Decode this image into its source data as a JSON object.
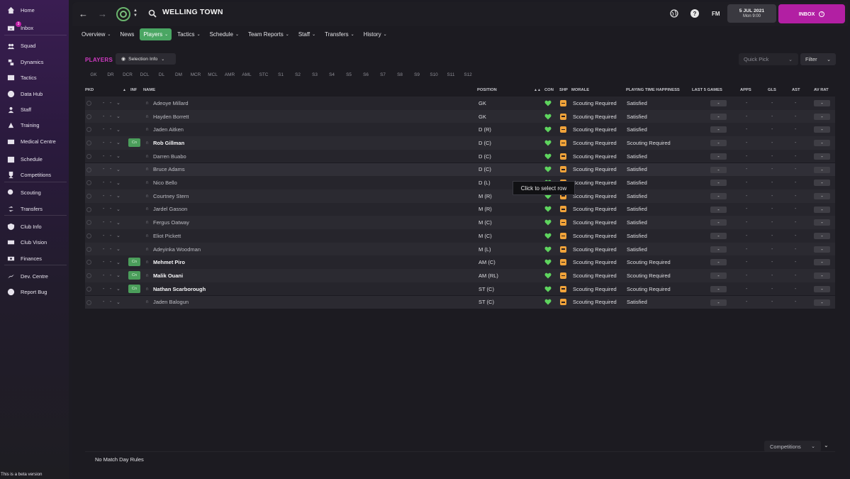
{
  "sidebar": {
    "items": [
      {
        "label": "Home",
        "icon": "home-icon"
      },
      {
        "label": "Inbox",
        "icon": "inbox-icon",
        "badge": "3"
      },
      {
        "label": "Squad",
        "icon": "squad-icon"
      },
      {
        "label": "Dynamics",
        "icon": "dynamics-icon"
      },
      {
        "label": "Tactics",
        "icon": "tactics-icon"
      },
      {
        "label": "Data Hub",
        "icon": "data-hub-icon"
      },
      {
        "label": "Staff",
        "icon": "staff-icon"
      },
      {
        "label": "Training",
        "icon": "training-icon"
      },
      {
        "label": "Medical Centre",
        "icon": "medical-icon"
      },
      {
        "label": "Schedule",
        "icon": "schedule-icon"
      },
      {
        "label": "Competitions",
        "icon": "trophy-icon"
      },
      {
        "label": "Scouting",
        "icon": "scouting-icon"
      },
      {
        "label": "Transfers",
        "icon": "transfers-icon"
      },
      {
        "label": "Club Info",
        "icon": "shield-icon"
      },
      {
        "label": "Club Vision",
        "icon": "vision-icon"
      },
      {
        "label": "Finances",
        "icon": "finances-icon"
      },
      {
        "label": "Dev. Centre",
        "icon": "dev-centre-icon"
      },
      {
        "label": "Report Bug",
        "icon": "report-bug-icon"
      }
    ],
    "beta_text": "This is a beta version"
  },
  "header": {
    "club_name": "WELLING TOWN",
    "fm_label": "FM",
    "date": "5 JUL 2021",
    "day_time": "Mon 9:00",
    "inbox_label": "INBOX"
  },
  "menu": [
    {
      "label": "Overview",
      "caret": true
    },
    {
      "label": "News",
      "caret": false
    },
    {
      "label": "Players",
      "caret": true,
      "active": true
    },
    {
      "label": "Tactics",
      "caret": true
    },
    {
      "label": "Schedule",
      "caret": true
    },
    {
      "label": "Team Reports",
      "caret": true
    },
    {
      "label": "Staff",
      "caret": true
    },
    {
      "label": "Transfers",
      "caret": true
    },
    {
      "label": "History",
      "caret": true
    }
  ],
  "players_panel": {
    "title": "PLAYERS",
    "selection_info": "Selection Info",
    "quick_pick": "Quick Pick",
    "filter": "Filter",
    "positions": [
      "GK",
      "DR",
      "DCR",
      "DCL",
      "DL",
      "DM",
      "MCR",
      "MCL",
      "AMR",
      "AML",
      "STC",
      "S1",
      "S2",
      "S3",
      "S4",
      "S5",
      "S6",
      "S7",
      "S8",
      "S9",
      "S10",
      "S11",
      "S12"
    ]
  },
  "table": {
    "headers": {
      "pkd": "PKD",
      "inf": "INF",
      "name": "NAME",
      "position": "POSITION",
      "con": "CON",
      "shp": "SHP",
      "morale": "MORALE",
      "happiness": "PLAYING TIME HAPPINESS",
      "last5": "LAST 5 GAMES",
      "apps": "APPS",
      "gls": "GLS",
      "ast": "AST",
      "avrat": "AV RAT"
    },
    "rows": [
      {
        "name": "Adeoye Millard",
        "position": "GK",
        "morale": "Scouting Required",
        "happiness": "Satisfied",
        "cn": false,
        "bold": false
      },
      {
        "name": "Hayden Borrett",
        "position": "GK",
        "morale": "Scouting Required",
        "happiness": "Satisfied",
        "cn": false,
        "bold": false
      },
      {
        "name": "Jaden Aitken",
        "position": "D (R)",
        "morale": "Scouting Required",
        "happiness": "Satisfied",
        "cn": false,
        "bold": false
      },
      {
        "name": "Rob Gillman",
        "position": "D (C)",
        "morale": "Scouting Required",
        "happiness": "Scouting Required",
        "cn": true,
        "bold": true
      },
      {
        "name": "Darren Buabo",
        "position": "D (C)",
        "morale": "Scouting Required",
        "happiness": "Satisfied",
        "cn": false,
        "bold": false
      },
      {
        "name": "Bruce Adams",
        "position": "D (C)",
        "morale": "Scouting Required",
        "happiness": "Satisfied",
        "cn": false,
        "bold": false
      },
      {
        "name": "Nico Bello",
        "position": "D (L)",
        "morale": "Scouting Required",
        "happiness": "Satisfied",
        "cn": false,
        "bold": false
      },
      {
        "name": "Courtney Stern",
        "position": "M (R)",
        "morale": "Scouting Required",
        "happiness": "Satisfied",
        "cn": false,
        "bold": false
      },
      {
        "name": "Jardel Gasson",
        "position": "M (R)",
        "morale": "Scouting Required",
        "happiness": "Satisfied",
        "cn": false,
        "bold": false
      },
      {
        "name": "Fergus Oatway",
        "position": "M (C)",
        "morale": "Scouting Required",
        "happiness": "Satisfied",
        "cn": false,
        "bold": false
      },
      {
        "name": "Eliot Pickett",
        "position": "M (C)",
        "morale": "Scouting Required",
        "happiness": "Satisfied",
        "cn": false,
        "bold": false
      },
      {
        "name": "Adeyinka Woodman",
        "position": "M (L)",
        "morale": "Scouting Required",
        "happiness": "Satisfied",
        "cn": false,
        "bold": false
      },
      {
        "name": "Mehmet Piro",
        "position": "AM (C)",
        "morale": "Scouting Required",
        "happiness": "Scouting Required",
        "cn": true,
        "bold": true
      },
      {
        "name": "Malik Ouani",
        "position": "AM (RL)",
        "morale": "Scouting Required",
        "happiness": "Scouting Required",
        "cn": true,
        "bold": true
      },
      {
        "name": "Nathan Scarborough",
        "position": "ST (C)",
        "morale": "Scouting Required",
        "happiness": "Scouting Required",
        "cn": true,
        "bold": true
      },
      {
        "name": "Jaden Balogun",
        "position": "ST (C)",
        "morale": "Scouting Required",
        "happiness": "Satisfied",
        "cn": false,
        "bold": false
      }
    ],
    "dash": "-",
    "cn_label": "Cn",
    "tooltip": "Click to select row"
  },
  "footer": {
    "competitions": "Competitions",
    "no_match_rules": "No Match Day Rules"
  },
  "colors": {
    "accent": "#b21fa3",
    "players_title": "#d23ac4",
    "menu_active": "#4aa663",
    "heart": "#5ed45e",
    "shape": "#f0a33a"
  }
}
